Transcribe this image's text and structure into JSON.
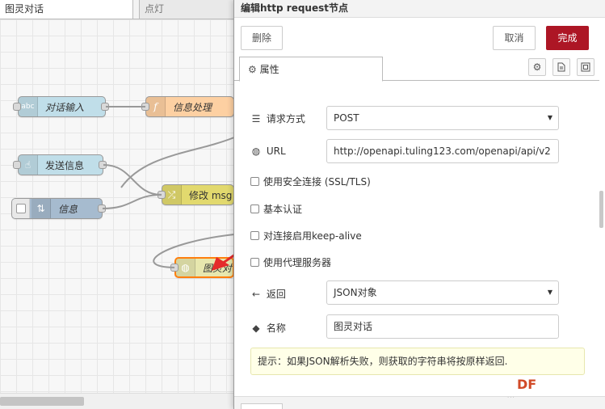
{
  "workspace": {
    "tabs": [
      "图灵对话",
      "点灯"
    ],
    "nodes": {
      "dialog_input": "对话输入",
      "info_process": "信息处理",
      "send_info": "发送信息",
      "modify_msg": "修改 msg",
      "info": "信息",
      "turing": "图灵对"
    },
    "node_icons": {
      "dialog_input": "abc-icon",
      "info_process": "function-icon",
      "send_info": "hand-icon",
      "modify_msg": "shuffle-icon",
      "info": "arrows-icon",
      "turing": "globe-icon"
    },
    "colors": {
      "inject_node": "#c0dee9",
      "function_node": "#fdd0a2",
      "change_node": "#e2d96e",
      "link_node": "#a6bbcf",
      "http_node": "#e7e7ae",
      "selected_border": "#ff7f0e",
      "arrow": "#e52b2b"
    }
  },
  "tray": {
    "title": "编辑http request节点",
    "buttons": {
      "delete": "删除",
      "cancel": "取消",
      "done": "完成"
    },
    "done_color": "#ad1625",
    "tabs": {
      "properties": "属性",
      "properties_icon": "gear-icon"
    },
    "form": {
      "method_label": "请求方式",
      "method_value": "POST",
      "url_label": "URL",
      "url_value": "http://openapi.tuling123.com/openapi/api/v2",
      "tls_label": "使用安全连接 (SSL/TLS)",
      "basic_auth_label": "基本认证",
      "keepalive_label": "对连接启用keep-alive",
      "proxy_label": "使用代理服务器",
      "return_label": "返回",
      "return_value": "JSON对象",
      "name_label": "名称",
      "name_value": "图灵对话"
    },
    "tip": "提示：如果JSON解析失败，则获取的字符串将按原样返回."
  },
  "watermark": {
    "logo": "DF",
    "sub": "···"
  }
}
